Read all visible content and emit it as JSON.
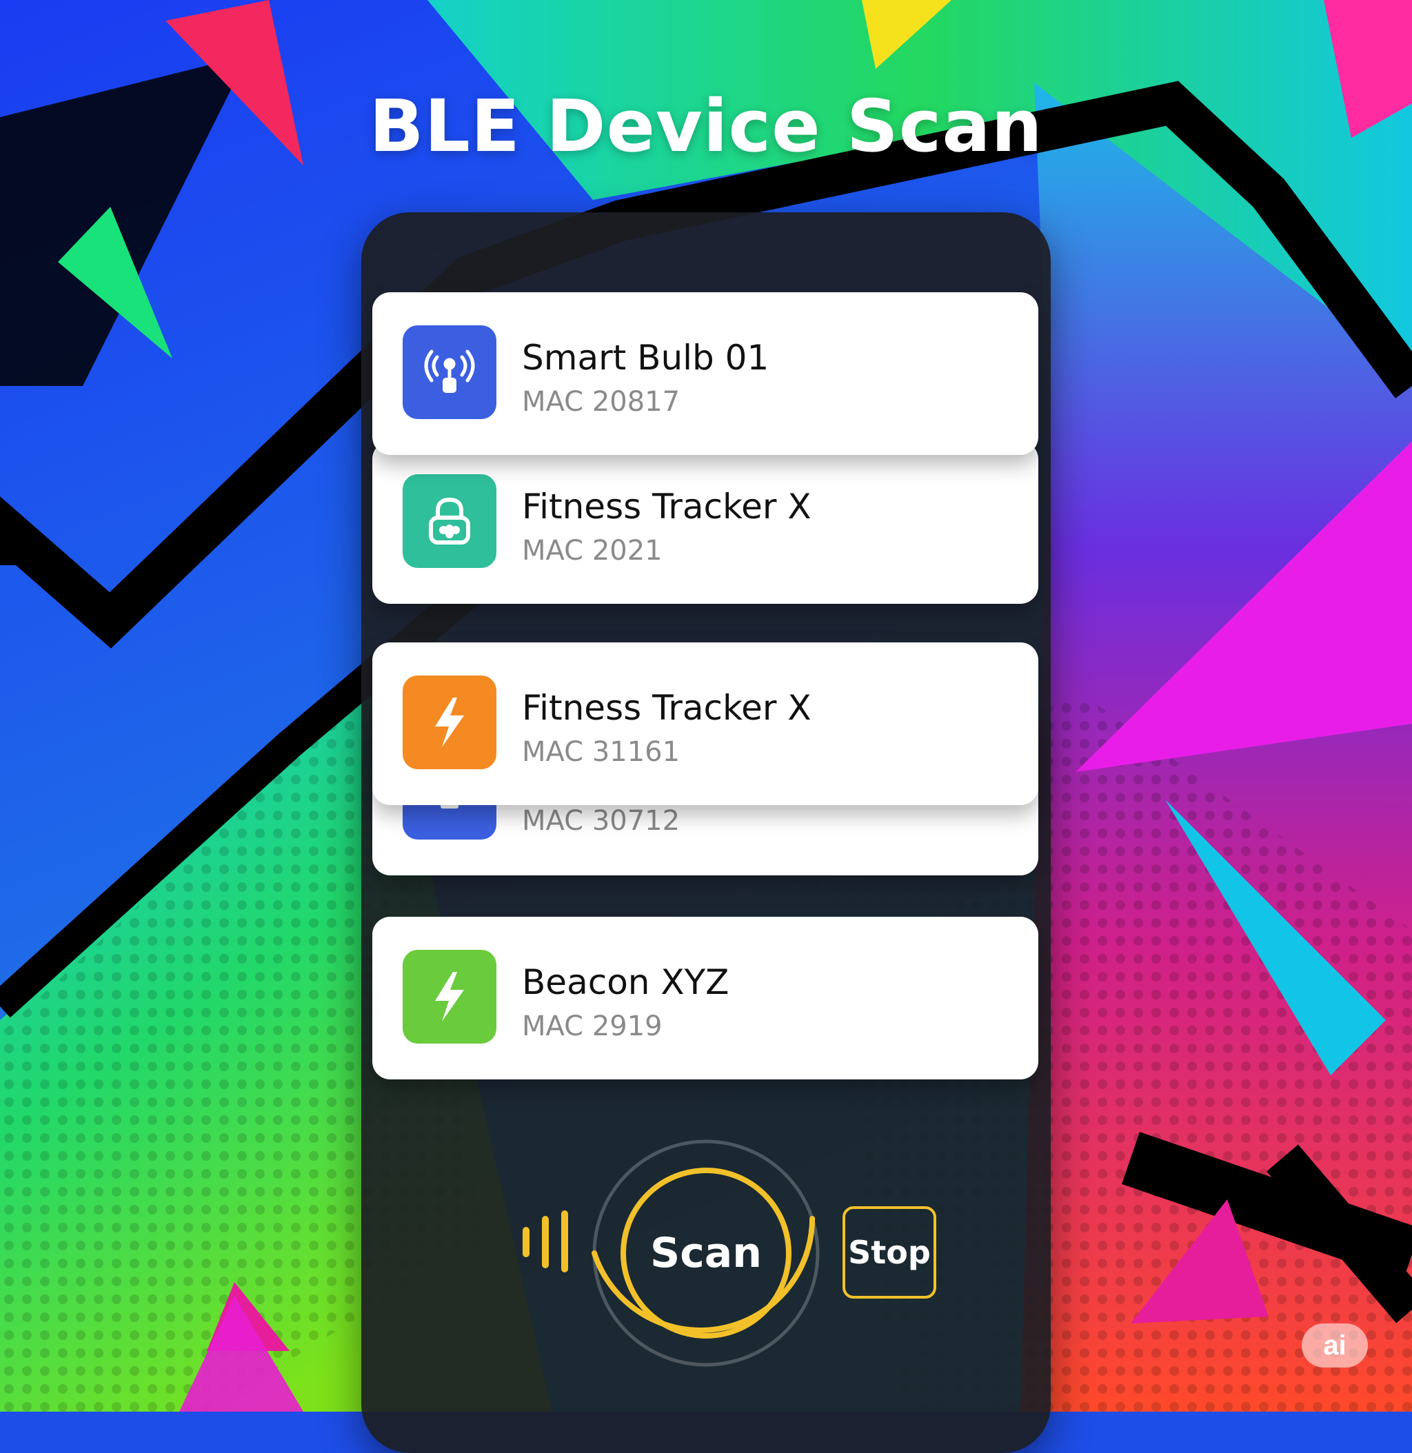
{
  "header": {
    "title": "BLE Device Scan"
  },
  "devices": [
    {
      "name": "Smart Bulb 01",
      "mac": "MAC 20817",
      "icon": "antenna-icon",
      "color": "#3b5fe0"
    },
    {
      "name": "Fitness Tracker X",
      "mac": "MAC 2021",
      "icon": "padlock-icon",
      "color": "#2fbf9a"
    },
    {
      "name": "",
      "mac": "MAC 30712",
      "icon": "antenna-icon",
      "color": "#3b5fe0"
    },
    {
      "name": "Fitness Tracker X",
      "mac": "MAC 31161",
      "icon": "lightning-icon",
      "color": "#f58a22"
    },
    {
      "name": "Beacon XYZ",
      "mac": "MAC 2919",
      "icon": "lightning-icon",
      "color": "#6acb3c"
    }
  ],
  "controls": {
    "scan_label": "Scan",
    "stop_label": "Stop",
    "scan_progress": 0.45,
    "accent_color": "#f2c12a"
  },
  "badge": {
    "label": "ai"
  }
}
